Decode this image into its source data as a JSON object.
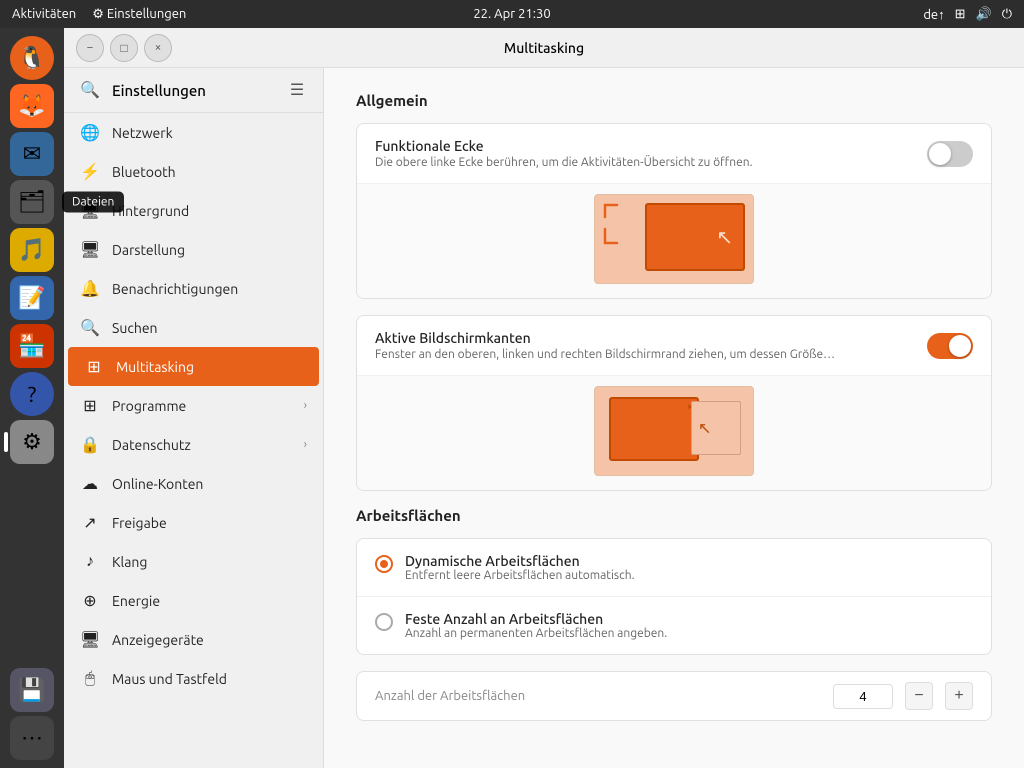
{
  "taskbar": {
    "left": [
      "Aktivitäten"
    ],
    "left_icon": "⚙",
    "settings_label": "Einstellungen",
    "datetime": "22. Apr  21:30",
    "lang": "de↑",
    "icons": [
      "network-icon",
      "volume-icon",
      "power-icon"
    ]
  },
  "dock": {
    "items": [
      {
        "name": "ubuntu-icon",
        "icon": "🐧",
        "color": "#e8611a",
        "bg": "#e8611a"
      },
      {
        "name": "firefox-icon",
        "icon": "🦊",
        "bg": "#ff6611"
      },
      {
        "name": "thunderbird-icon",
        "icon": "✉",
        "bg": "#3377cc"
      },
      {
        "name": "files-icon",
        "icon": "🗂",
        "bg": "#555",
        "tooltip": "Dateien"
      },
      {
        "name": "rhythmbox-icon",
        "icon": "🎵",
        "bg": "#f0c000"
      },
      {
        "name": "writer-icon",
        "icon": "📝",
        "bg": "#4488cc"
      },
      {
        "name": "appstore-icon",
        "icon": "🏪",
        "bg": "#cc2200"
      },
      {
        "name": "help-icon",
        "icon": "?",
        "bg": "#3355aa"
      },
      {
        "name": "settings-icon",
        "icon": "⚙",
        "bg": "#888",
        "active": true
      },
      {
        "name": "manager-icon",
        "icon": "💾",
        "bg": "#667"
      },
      {
        "name": "apps-icon",
        "icon": "⋯",
        "bg": "#555"
      }
    ]
  },
  "window": {
    "title": "Multitasking",
    "sidebar_title": "Einstellungen",
    "controls": {
      "minimize": "−",
      "maximize": "□",
      "close": "×"
    }
  },
  "sidebar": {
    "search_placeholder": "Suchen...",
    "items": [
      {
        "label": "Netzwerk",
        "icon": "🌐",
        "has_arrow": false
      },
      {
        "label": "Bluetooth",
        "icon": "⚡",
        "has_arrow": false
      },
      {
        "label": "Hintergrund",
        "icon": "🖥",
        "has_arrow": false
      },
      {
        "label": "Darstellung",
        "icon": "🖥",
        "has_arrow": false
      },
      {
        "label": "Benachrichtigungen",
        "icon": "🔔",
        "has_arrow": false
      },
      {
        "label": "Suchen",
        "icon": "🔍",
        "has_arrow": false
      },
      {
        "label": "Multitasking",
        "icon": "⊞",
        "has_arrow": false,
        "active": true
      },
      {
        "label": "Programme",
        "icon": "⊞",
        "has_arrow": true
      },
      {
        "label": "Datenschutz",
        "icon": "🔒",
        "has_arrow": true
      },
      {
        "label": "Online-Konten",
        "icon": "☁",
        "has_arrow": false
      },
      {
        "label": "Freigabe",
        "icon": "↗",
        "has_arrow": false
      },
      {
        "label": "Klang",
        "icon": "♪",
        "has_arrow": false
      },
      {
        "label": "Energie",
        "icon": "⊕",
        "has_arrow": false
      },
      {
        "label": "Anzeigegeräte",
        "icon": "🖥",
        "has_arrow": false
      },
      {
        "label": "Maus und Tastfeld",
        "icon": "🖱",
        "has_arrow": false
      }
    ]
  },
  "content": {
    "section_allgemein": "Allgemein",
    "funktionale_ecke": {
      "title": "Funktionale Ecke",
      "desc": "Die obere linke Ecke berühren, um die Aktivitäten-Übersicht zu öffnen.",
      "enabled": false
    },
    "aktive_bildschirmkanten": {
      "title": "Aktive Bildschirmkanten",
      "desc": "Fenster an den oberen, linken und rechten Bildschirmrand ziehen, um dessen Größe…",
      "enabled": true
    },
    "section_arbeitsflaechen": "Arbeitsflächen",
    "dynamische": {
      "title": "Dynamische Arbeitsflächen",
      "desc": "Entfernt leere Arbeitsflächen automatisch.",
      "checked": true
    },
    "feste_anzahl": {
      "title": "Feste Anzahl an Arbeitsflächen",
      "desc": "Anzahl an permanenten Arbeitsflächen angeben.",
      "checked": false
    },
    "counter": {
      "label": "Anzahl der Arbeitsflächen",
      "value": "4",
      "minus": "−",
      "plus": "+"
    }
  }
}
